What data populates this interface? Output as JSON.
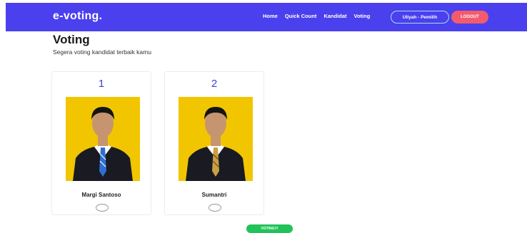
{
  "brand": "e-voting.",
  "nav": {
    "links": [
      "Home",
      "Quick Count",
      "Kandidat",
      "Voting"
    ],
    "user": "Uliyah - Pemilih",
    "logout": "LOGOUT"
  },
  "page": {
    "title": "Voting",
    "subtitle": "Segera voting kandidat terbaik kamu"
  },
  "candidates": [
    {
      "number": "1",
      "name": "Margi Santoso",
      "tie_color": "#2f6fd1"
    },
    {
      "number": "2",
      "name": "Sumantri",
      "tie_color": "#c9a045"
    }
  ],
  "colors": {
    "navbar": "#4a40ee",
    "logout": "#f35b6c",
    "vote_button": "#22c25a",
    "photo_background": "#f1c600",
    "number_color": "#3d3fd6"
  },
  "vote_button": "VOTING!!!"
}
